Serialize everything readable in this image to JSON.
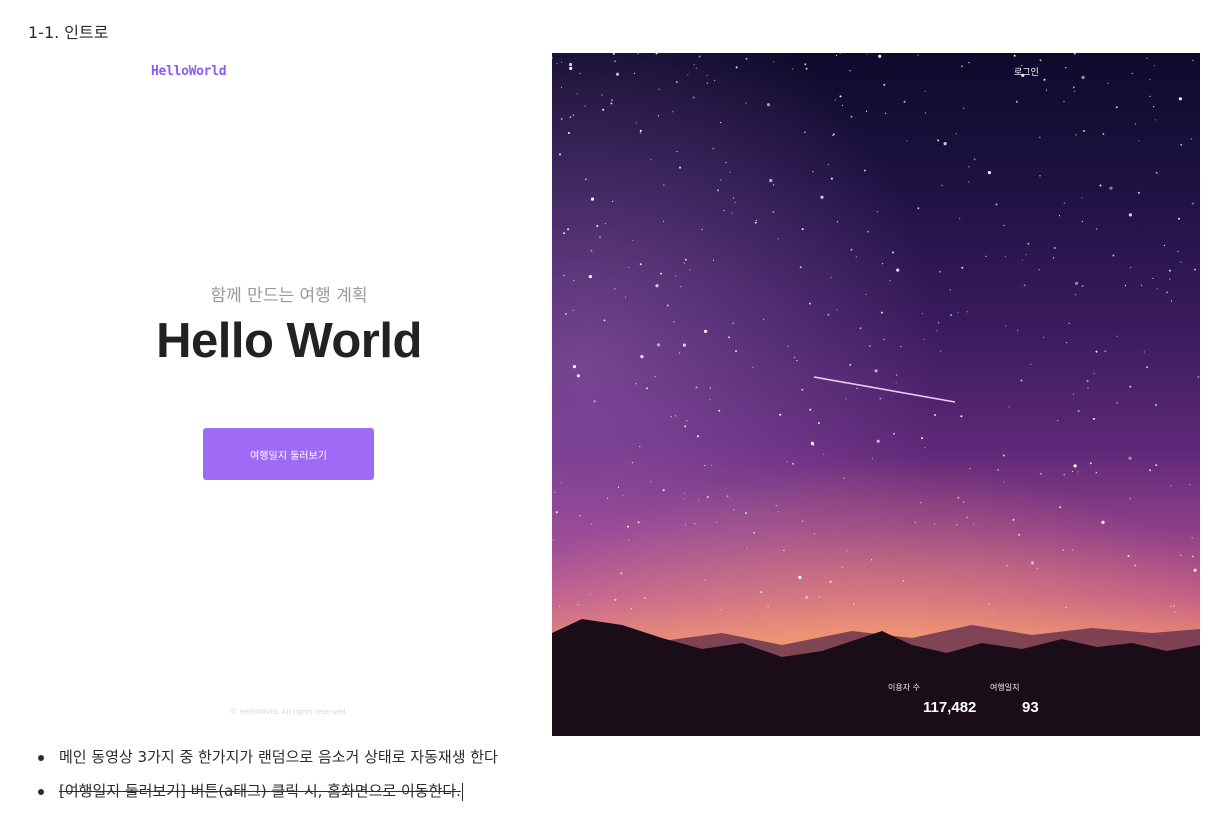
{
  "section": {
    "heading": "1-1. 인트로"
  },
  "mockup": {
    "logo": "HelloWorld",
    "tagline": "함께 만드는 여행 계획",
    "title": "Hello World",
    "cta_label": "여행일지 둘러보기",
    "copyright": "© HelloWorld. All rights reserved.",
    "login_label": "로그인",
    "stats": [
      {
        "label": "이용자 수",
        "value": "117,482"
      },
      {
        "label": "여행일지",
        "value": "93"
      }
    ],
    "accent_color": "#a06bf4"
  },
  "notes": [
    {
      "text": "메인 동영상 3가지 중 한가지가 랜덤으로 음소거 상태로 자동재생 한다",
      "struck": false
    },
    {
      "text": "[여행일지 둘러보기] 버튼(a태그) 클릭 시, 홈화면으로 이동한다.",
      "struck": true
    }
  ]
}
